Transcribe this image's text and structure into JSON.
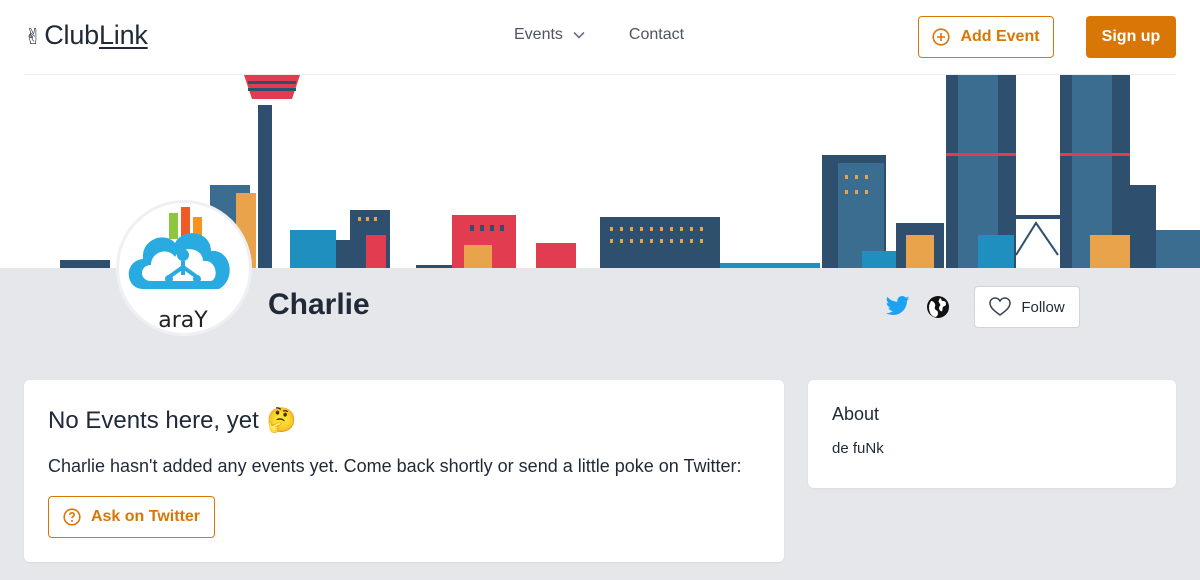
{
  "header": {
    "logo_prefix": "Club",
    "logo_suffix": "Link",
    "logo_emoji": "✌",
    "nav": [
      {
        "label": "Events",
        "icon": "chevron-down-icon"
      },
      {
        "label": "Contact"
      }
    ],
    "add_event_label": "Add Event",
    "signup_label": "Sign up"
  },
  "profile": {
    "name": "Charlie",
    "avatar_text": "araY",
    "follow_label": "Follow",
    "social_icons": [
      "twitter-icon",
      "globe-icon"
    ]
  },
  "events_card": {
    "title": "No Events here, yet",
    "title_emoji": "🤔",
    "message": "Charlie hasn't added any events yet. Come back shortly or send a little poke on Twitter:",
    "ask_label": "Ask on Twitter"
  },
  "about_card": {
    "title": "About",
    "text": "de fuNk"
  },
  "colors": {
    "accent": "#d97706",
    "twitter": "#1da1f2",
    "page_bg": "#e5e7eb"
  }
}
